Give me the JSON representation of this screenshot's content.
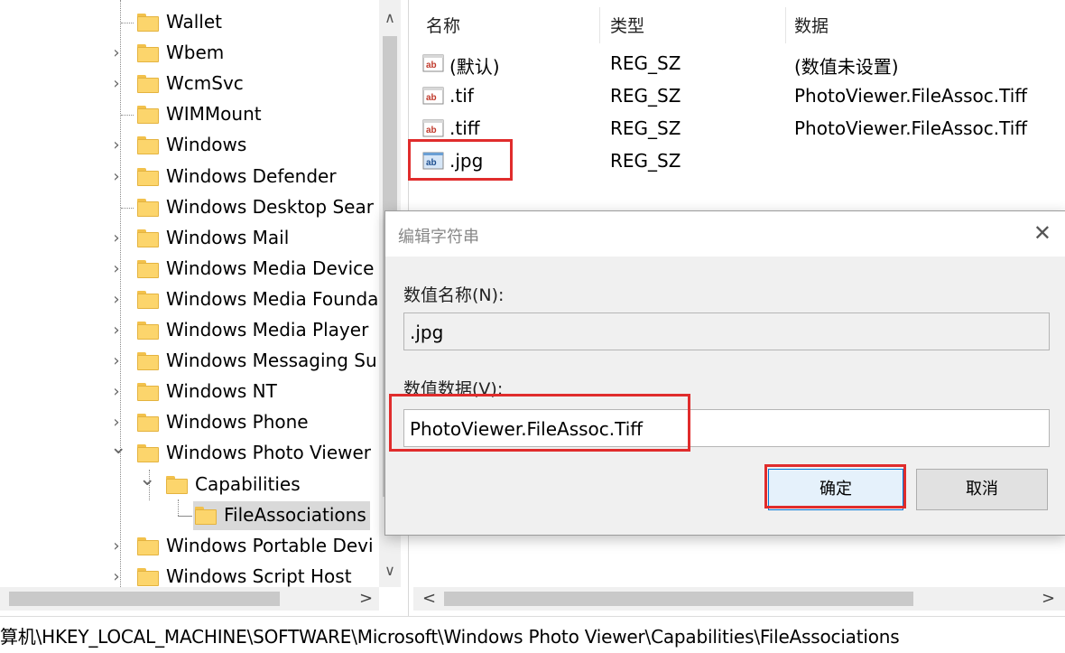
{
  "tree": {
    "items": [
      {
        "label": "Wallet",
        "expander": ""
      },
      {
        "label": "Wbem",
        "expander": ">"
      },
      {
        "label": "WcmSvc",
        "expander": ">"
      },
      {
        "label": "WIMMount",
        "expander": ""
      },
      {
        "label": "Windows",
        "expander": ">"
      },
      {
        "label": "Windows Defender",
        "expander": ">"
      },
      {
        "label": "Windows Desktop Sear",
        "expander": ""
      },
      {
        "label": "Windows Mail",
        "expander": ">"
      },
      {
        "label": "Windows Media Device",
        "expander": ">"
      },
      {
        "label": "Windows Media Founda",
        "expander": ">"
      },
      {
        "label": "Windows Media Player",
        "expander": ">"
      },
      {
        "label": "Windows Messaging Su",
        "expander": ">"
      },
      {
        "label": "Windows NT",
        "expander": ">"
      },
      {
        "label": "Windows Phone",
        "expander": ">"
      },
      {
        "label": "Windows Photo Viewer",
        "expander": "v"
      },
      {
        "label": "Capabilities",
        "expander": "v"
      },
      {
        "label": "FileAssociations",
        "expander": ""
      },
      {
        "label": "Windows Portable Devi",
        "expander": ">"
      },
      {
        "label": "Windows Script Host",
        "expander": ">"
      }
    ],
    "selected": "FileAssociations",
    "scroll_up": "∧",
    "scroll_down": "∨",
    "scroll_right": ">"
  },
  "list": {
    "columns": [
      "名称",
      "类型",
      "数据"
    ],
    "rows": [
      {
        "name": "(默认)",
        "type": "REG_SZ",
        "data": "(数值未设置)",
        "icon": "string-value-icon"
      },
      {
        "name": ".tif",
        "type": "REG_SZ",
        "data": "PhotoViewer.FileAssoc.Tiff",
        "icon": "string-value-icon"
      },
      {
        "name": ".tiff",
        "type": "REG_SZ",
        "data": "PhotoViewer.FileAssoc.Tiff",
        "icon": "string-value-icon"
      },
      {
        "name": ".jpg",
        "type": "REG_SZ",
        "data": "",
        "icon": "string-value-icon"
      }
    ],
    "scroll_left": "<",
    "scroll_right": ">"
  },
  "dialog": {
    "title": "编辑字符串",
    "close_glyph": "✕",
    "value_name_label": "数值名称(N):",
    "value_name": ".jpg",
    "value_data_label": "数值数据(V):",
    "value_data": "PhotoViewer.FileAssoc.Tiff",
    "ok_label": "确定",
    "cancel_label": "取消"
  },
  "status_bar": {
    "path": "算机\\HKEY_LOCAL_MACHINE\\SOFTWARE\\Microsoft\\Windows Photo Viewer\\Capabilities\\FileAssociations"
  },
  "colors": {
    "highlight": "#e02c2c",
    "folder": "#fcd56c",
    "selection": "#d9d9d9"
  }
}
